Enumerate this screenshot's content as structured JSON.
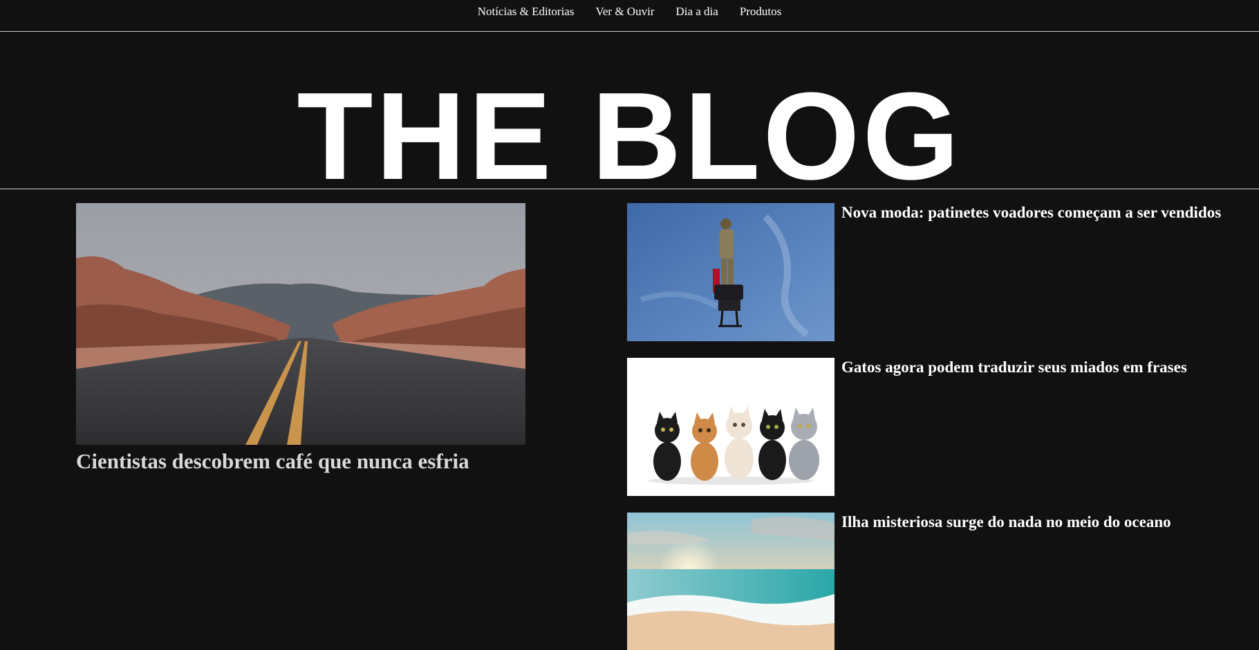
{
  "nav": {
    "items": [
      {
        "label": "Notícias & Editorias"
      },
      {
        "label": "Ver & Ouvir"
      },
      {
        "label": "Dia a dia"
      },
      {
        "label": "Produtos"
      }
    ]
  },
  "masthead": {
    "title": "THE BLOG"
  },
  "featured": {
    "image": "desert-road-photo",
    "title": "Cientistas descobrem café que nunca esfria"
  },
  "side_articles": [
    {
      "image": "flying-scooter-photo",
      "title": "Nova moda: patinetes voadores começam a ser vendidos"
    },
    {
      "image": "kittens-photo",
      "title": "Gatos agora podem traduzir seus miados em frases"
    },
    {
      "image": "beach-sunset-photo",
      "title": "Ilha misteriosa surge do nada no meio do oceano"
    }
  ]
}
